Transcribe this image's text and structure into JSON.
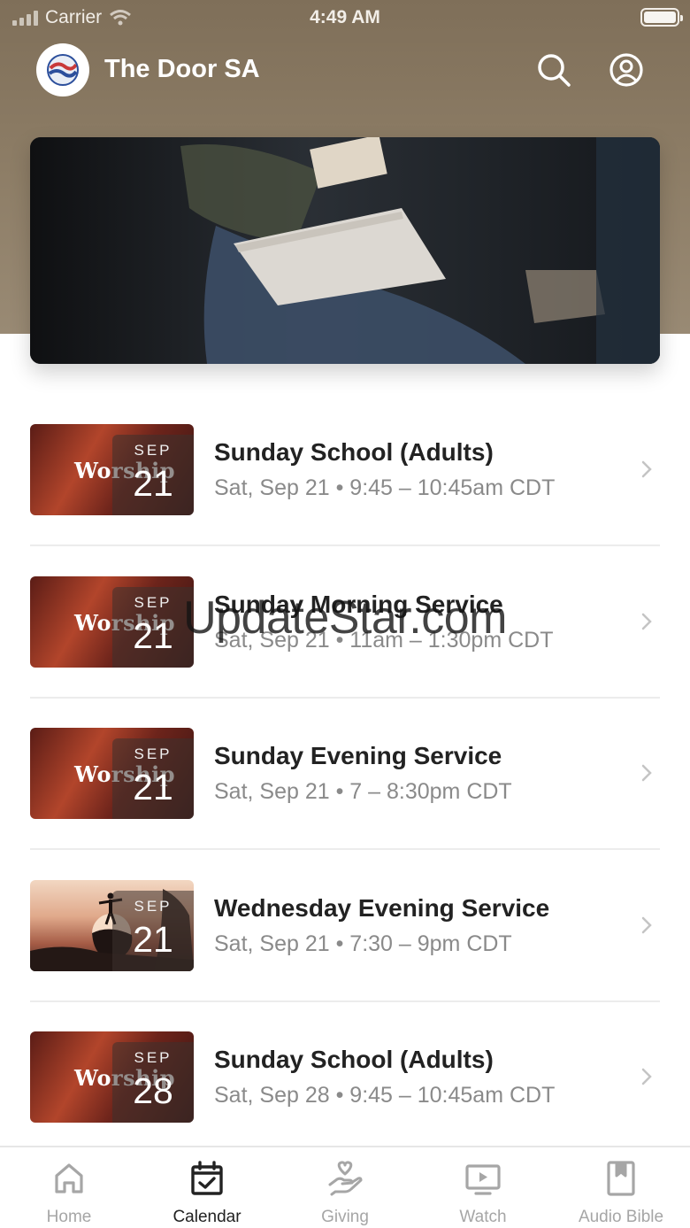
{
  "status_bar": {
    "carrier": "Carrier",
    "time": "4:49 AM"
  },
  "header": {
    "title": "The Door SA"
  },
  "events": [
    {
      "month": "SEP",
      "day": "21",
      "title": "Sunday School (Adults)",
      "subtitle": "Sat, Sep 21 • 9:45 – 10:45am CDT",
      "thumb_text": "Worship",
      "thumb_style": "worship"
    },
    {
      "month": "SEP",
      "day": "21",
      "title": "Sunday Morning Service",
      "subtitle": "Sat, Sep 21 • 11am – 1:30pm CDT",
      "thumb_text": "Worship",
      "thumb_style": "worship"
    },
    {
      "month": "SEP",
      "day": "21",
      "title": "Sunday Evening Service",
      "subtitle": "Sat, Sep 21 • 7 – 8:30pm CDT",
      "thumb_text": "Worship",
      "thumb_style": "worship"
    },
    {
      "month": "SEP",
      "day": "21",
      "title": "Wednesday Evening Service",
      "subtitle": "Sat, Sep 21 • 7:30 – 9pm CDT",
      "thumb_text": "",
      "thumb_style": "sunset"
    },
    {
      "month": "SEP",
      "day": "28",
      "title": "Sunday School (Adults)",
      "subtitle": "Sat, Sep 28 • 9:45 – 10:45am CDT",
      "thumb_text": "Worship",
      "thumb_style": "worship"
    }
  ],
  "watermark": "UpdateStar.com",
  "tabs": [
    {
      "label": "Home",
      "icon": "home-icon",
      "active": false
    },
    {
      "label": "Calendar",
      "icon": "calendar-icon",
      "active": true
    },
    {
      "label": "Giving",
      "icon": "giving-icon",
      "active": false
    },
    {
      "label": "Watch",
      "icon": "watch-icon",
      "active": false
    },
    {
      "label": "Audio Bible",
      "icon": "audio-bible-icon",
      "active": false
    }
  ],
  "colors": {
    "header_bg": "#8d7d66",
    "active_tab": "#222222",
    "inactive_tab": "#a6a6a6"
  }
}
